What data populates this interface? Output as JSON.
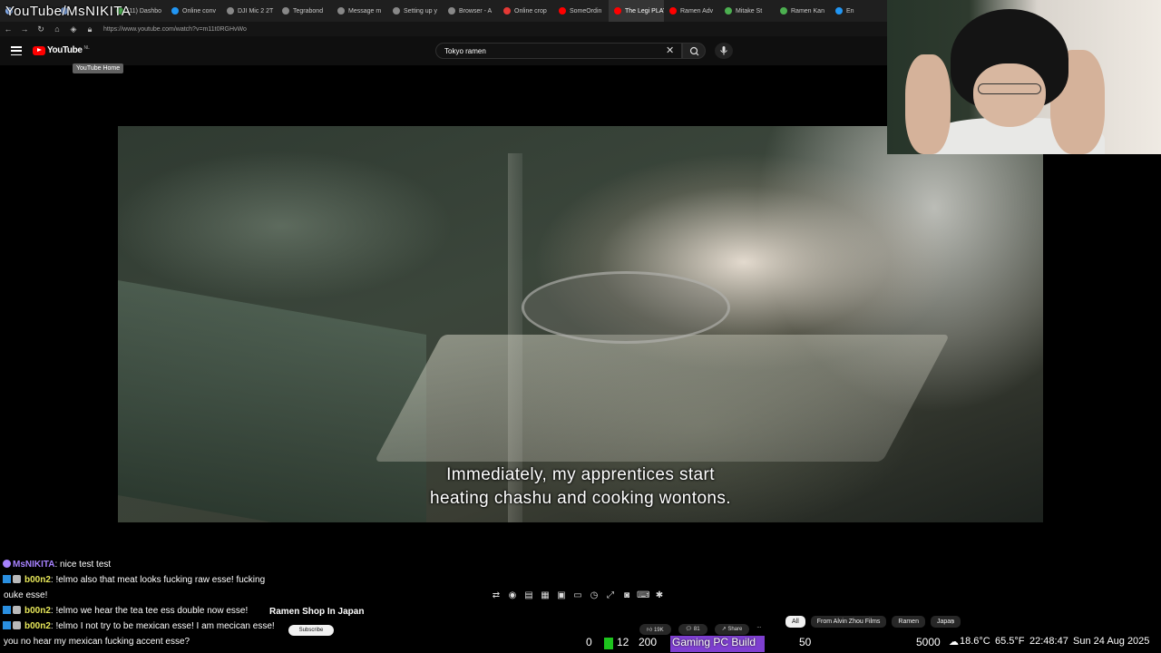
{
  "stream_overlay": {
    "title": "YouTube/MsNIKITA"
  },
  "browser": {
    "tabs": [
      {
        "label": "",
        "icon": "globe-icon",
        "color": "#8ab4f8"
      },
      {
        "label": "",
        "icon": "globe-icon",
        "color": "#8ab4f8"
      },
      {
        "label": "(11) Dashbo",
        "icon": "globe-icon",
        "color": "#4caf50"
      },
      {
        "label": "Online conv",
        "icon": "globe-icon",
        "color": "#2196f3"
      },
      {
        "label": "DJI Mic 2 2T",
        "icon": "globe-icon",
        "color": "#888888"
      },
      {
        "label": "Tegrabond",
        "icon": "globe-icon",
        "color": "#888888"
      },
      {
        "label": "Message m",
        "icon": "globe-icon",
        "color": "#888888"
      },
      {
        "label": "Setting up y",
        "icon": "globe-icon",
        "color": "#888888"
      },
      {
        "label": "Browser - A",
        "icon": "globe-icon",
        "color": "#888888"
      },
      {
        "label": "Online crop",
        "icon": "globe-icon",
        "color": "#e53935"
      },
      {
        "label": "SomeOrdin",
        "icon": "youtube-icon",
        "color": "#ff0000"
      },
      {
        "label": "The Legi PLAYING",
        "icon": "youtube-icon",
        "color": "#ff0000",
        "active": true
      },
      {
        "label": "Ramen Adv",
        "icon": "youtube-icon",
        "color": "#ff0000"
      },
      {
        "label": "Mitake St",
        "icon": "map-pin-icon",
        "color": "#4caf50"
      },
      {
        "label": "Ramen Kan",
        "icon": "map-pin-icon",
        "color": "#4caf50"
      },
      {
        "label": "En",
        "icon": "globe-icon",
        "color": "#2196f3"
      }
    ],
    "url": "https://www.youtube.com/watch?v=m11t0RGHvWo"
  },
  "youtube": {
    "logo_text": "YouTube",
    "region": "NL",
    "tooltip": "YouTube Home",
    "search_value": "Tokyo ramen",
    "subtitle_line1": "Immediately, my apprentices start",
    "subtitle_line2": "heating chashu and cooking wontons.",
    "video_title": "Ramen Shop In Japan",
    "subscribe_label": "Subscribe",
    "likes": "19K",
    "comments": "81",
    "share_label": "Share",
    "more_label": "...",
    "chips": [
      "All",
      "From Alvin Zhou Films",
      "Ramen",
      "Japan"
    ],
    "chip_next": "›"
  },
  "chat": {
    "messages": [
      {
        "user": "MsNIKITA",
        "text": ": nice test test",
        "color": "#a782ff"
      },
      {
        "user": "b00n2",
        "text": ": !elmo also that meat looks fucking raw esse! fucking",
        "color": "#e8e85a"
      },
      {
        "user": "",
        "text": "ouke esse!",
        "color": "#ffffff"
      },
      {
        "user": "b00n2",
        "text": ": !elmo we hear the tea tee ess double now esse!",
        "color": "#e8e85a"
      },
      {
        "user": "b00n2",
        "text": ": !elmo I not try to be mexican esse! I am mecican esse!",
        "color": "#e8e85a"
      },
      {
        "user": "",
        "text": "you no hear my mexican fucking accent esse?",
        "color": "#ffffff"
      }
    ]
  },
  "obs_toolbar": {
    "icons": [
      "repeat-icon",
      "audio-icon",
      "layers-icon",
      "film-icon",
      "crop-icon",
      "window-icon",
      "clock-icon",
      "expand-icon",
      "camera-icon",
      "keyboard-icon",
      "settings-icon"
    ]
  },
  "status_bar": {
    "viewers": "0",
    "followers": "12",
    "value_200": "200",
    "goal_label": "Gaming PC Build",
    "goal_current": "50",
    "goal_target": "5000",
    "temp_c": "18.6°C",
    "temp_f": "65.5°F",
    "time": "22:48:47",
    "date": "Sun 24 Aug 2025",
    "accent_green": "#1dc41d",
    "accent_purple": "#7e3fd0"
  }
}
